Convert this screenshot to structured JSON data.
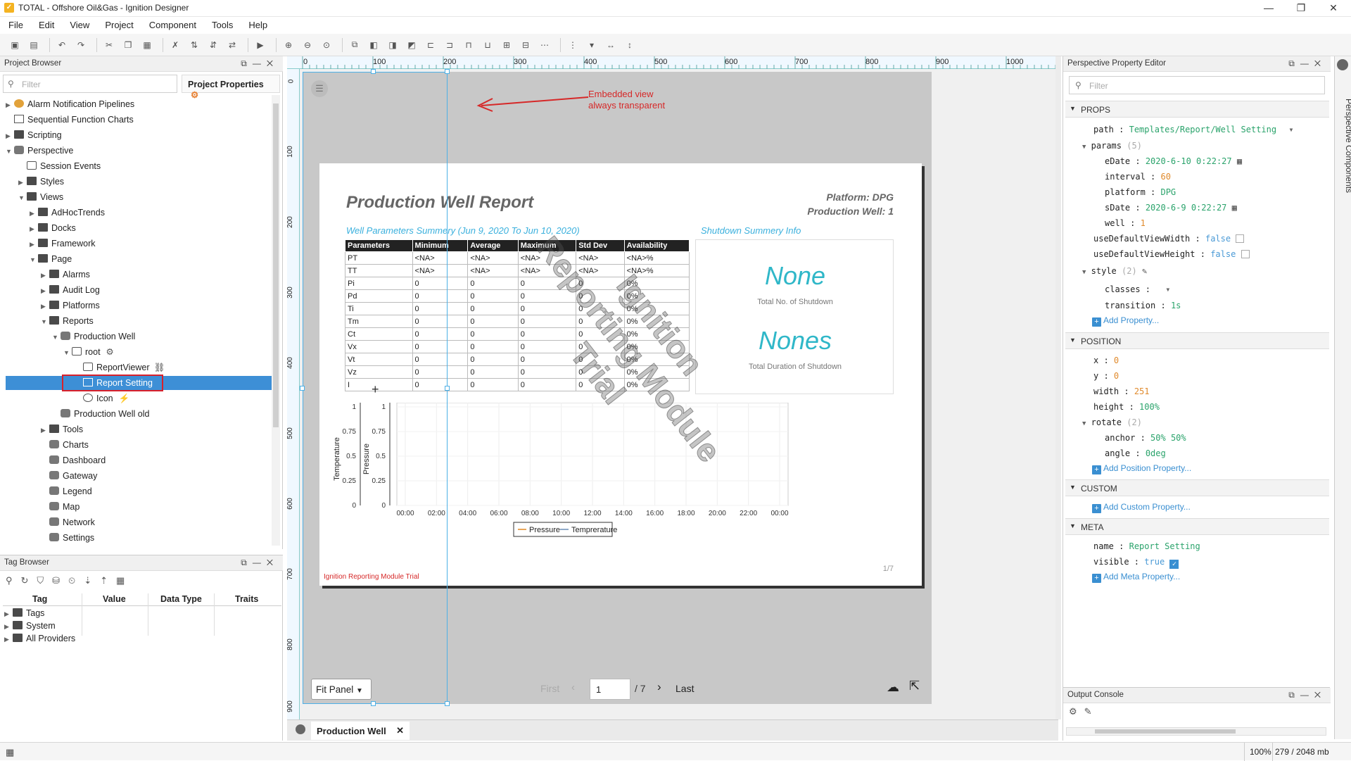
{
  "window": {
    "title": "TOTAL - Offshore Oil&Gas - Ignition Designer",
    "min": "—",
    "max": "❐",
    "close": "✕"
  },
  "menu": [
    "File",
    "Edit",
    "View",
    "Project",
    "Component",
    "Tools",
    "Help"
  ],
  "project_browser": {
    "title": "Project Browser",
    "filter_placeholder": "Filter",
    "project_properties": "Project Properties",
    "items": [
      "Alarm Notification Pipelines",
      "Sequential Function Charts",
      "Scripting",
      "Perspective",
      "Session Events",
      "Styles",
      "Views",
      "AdHocTrends",
      "Docks",
      "Framework",
      "Page",
      "Alarms",
      "Audit Log",
      "Platforms",
      "Reports",
      "Production Well",
      "root",
      "ReportViewer",
      "Report Setting",
      "Icon",
      "Production Well old",
      "Tools",
      "Charts",
      "Dashboard",
      "Gateway",
      "Legend",
      "Map",
      "Network",
      "Settings"
    ]
  },
  "tag_browser": {
    "title": "Tag Browser",
    "columns": [
      "Tag",
      "Value",
      "Data Type",
      "Traits"
    ],
    "items": [
      "Tags",
      "System",
      "All Providers"
    ]
  },
  "ruler": {
    "x_ticks": [
      "0",
      "100",
      "200",
      "300",
      "400",
      "500",
      "600",
      "700",
      "800",
      "900",
      "1000"
    ],
    "y_ticks": [
      "0",
      "100",
      "200",
      "300",
      "400",
      "500",
      "600",
      "700",
      "800",
      "900"
    ]
  },
  "annotation": {
    "line1": "Embedded view",
    "line2": "always transparent"
  },
  "report": {
    "title": "Production Well Report",
    "platform": "Platform: DPG",
    "well": "Production Well: 1",
    "params_heading": "Well Parameters Summery (Jun 9, 2020 To Jun 10, 2020)",
    "shutdown_heading": "Shutdown Summery Info",
    "table": {
      "columns": [
        "Parameters",
        "Minimum",
        "Average",
        "Maximum",
        "Std Dev",
        "Availability"
      ],
      "rows": [
        [
          "PT",
          "<NA>",
          "<NA>",
          "<NA>",
          "<NA>",
          "<NA>%"
        ],
        [
          "TT",
          "<NA>",
          "<NA>",
          "<NA>",
          "<NA>",
          "<NA>%"
        ],
        [
          "Pi",
          "0",
          "0",
          "0",
          "0",
          "0%"
        ],
        [
          "Pd",
          "0",
          "0",
          "0",
          "0",
          "0%"
        ],
        [
          "Ti",
          "0",
          "0",
          "0",
          "0",
          "0%"
        ],
        [
          "Tm",
          "0",
          "0",
          "0",
          "0",
          "0%"
        ],
        [
          "Ct",
          "0",
          "0",
          "0",
          "0",
          "0%"
        ],
        [
          "Vx",
          "0",
          "0",
          "0",
          "0",
          "0%"
        ],
        [
          "Vt",
          "0",
          "0",
          "0",
          "0",
          "0%"
        ],
        [
          "Vz",
          "0",
          "0",
          "0",
          "0",
          "0%"
        ],
        [
          "I",
          "0",
          "0",
          "0",
          "0",
          "0%"
        ]
      ]
    },
    "shutdown_count_value": "None",
    "shutdown_count_label": "Total No. of Shutdown",
    "shutdown_duration_value": "Nones",
    "shutdown_duration_label": "Total Duration of Shutdown",
    "watermark_line1": "Ignition",
    "watermark_line2": "Reporting Module",
    "watermark_line3": "Trial",
    "footer": "Ignition Reporting Module Trial",
    "page": "1/7"
  },
  "chart_data": {
    "type": "line",
    "x": [
      "00:00",
      "02:00",
      "04:00",
      "06:00",
      "08:00",
      "10:00",
      "12:00",
      "14:00",
      "16:00",
      "18:00",
      "20:00",
      "22:00",
      "00:00"
    ],
    "series": [
      {
        "name": "Pressure",
        "values": []
      },
      {
        "name": "Temprerature",
        "values": []
      }
    ],
    "ylabel_left": "Temperature",
    "ylabel_right": "Pressure",
    "ylim": [
      0,
      1
    ],
    "yticks": [
      "1",
      "0.75",
      "0.5",
      "0.25",
      "0"
    ],
    "legend": "bottom",
    "colors": {
      "Pressure": "#e8a65a",
      "Temprerature": "#8fa9c8"
    }
  },
  "viewer": {
    "fit": "Fit Panel",
    "first": "First",
    "page_value": "1",
    "of": "/ 7",
    "last": "Last"
  },
  "tab": {
    "label": "Production Well"
  },
  "property_editor": {
    "title": "Perspective Property Editor",
    "filter_placeholder": "Filter",
    "props": "PROPS",
    "path_key": "path",
    "path_val": "Templates/Report/Well Setting",
    "params_key": "params",
    "params_count": "(5)",
    "edate_key": "eDate",
    "edate_val": "2020-6-10 0:22:27",
    "interval_key": "interval",
    "interval_val": "60",
    "platform_key": "platform",
    "platform_val": "DPG",
    "sdate_key": "sDate",
    "sdate_val": "2020-6-9 0:22:27",
    "well_key": "well",
    "well_val": "1",
    "udvw_key": "useDefaultViewWidth",
    "udvw_val": "false",
    "udvh_key": "useDefaultViewHeight",
    "udvh_val": "false",
    "style_key": "style",
    "style_count": "(2)",
    "classes_key": "classes",
    "transition_key": "transition",
    "transition_val": "1s",
    "add_property": "Add Property...",
    "position": "POSITION",
    "x_key": "x",
    "x_val": "0",
    "y_key": "y",
    "y_val": "0",
    "width_key": "width",
    "width_val": "251",
    "height_key": "height",
    "height_val": "100%",
    "rotate_key": "rotate",
    "rotate_count": "(2)",
    "anchor_key": "anchor",
    "anchor_val": "50% 50%",
    "angle_key": "angle",
    "angle_val": "0deg",
    "add_position": "Add Position Property...",
    "custom": "CUSTOM",
    "add_custom": "Add Custom Property...",
    "meta": "META",
    "name_key": "name",
    "name_val": "Report Setting",
    "visible_key": "visible",
    "visible_val": "true",
    "add_meta": "Add Meta Property..."
  },
  "side_tab": "Perspective Components",
  "output_console": {
    "title": "Output Console"
  },
  "status": {
    "zoom": "100%",
    "memory": "279 / 2048 mb"
  }
}
